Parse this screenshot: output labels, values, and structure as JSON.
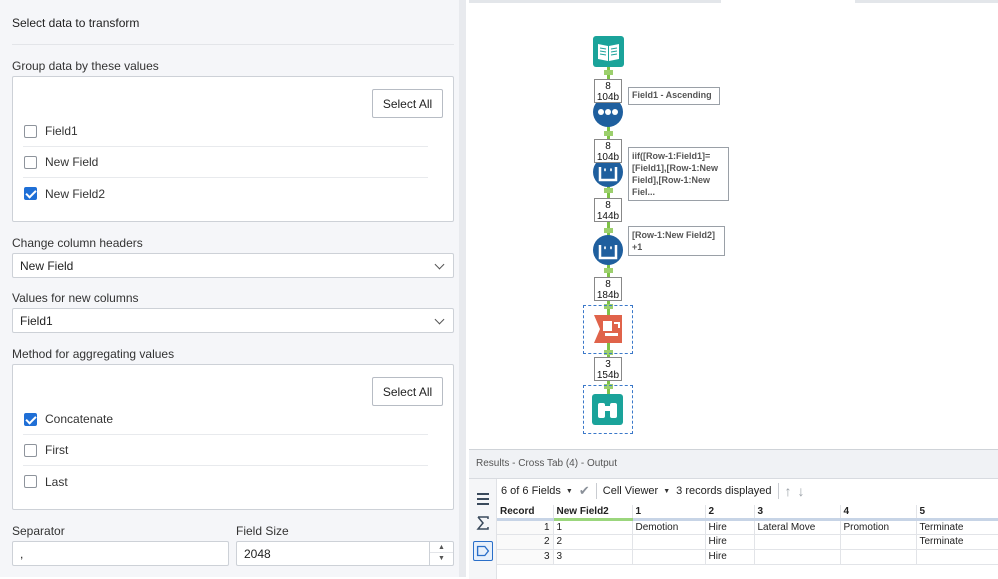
{
  "config": {
    "title": "Select data to transform",
    "group_section": {
      "label": "Group data by these values",
      "select_all": "Select All",
      "fields": [
        {
          "label": "Field1",
          "checked": false
        },
        {
          "label": "New Field",
          "checked": false
        },
        {
          "label": "New Field2",
          "checked": true
        }
      ]
    },
    "change_headers": {
      "label": "Change column headers",
      "value": "New Field"
    },
    "values_columns": {
      "label": "Values for new columns",
      "value": "Field1"
    },
    "aggregate_section": {
      "label": "Method for aggregating values",
      "select_all": "Select All",
      "methods": [
        {
          "label": "Concatenate",
          "checked": true
        },
        {
          "label": "First",
          "checked": false
        },
        {
          "label": "Last",
          "checked": false
        }
      ]
    },
    "separator": {
      "label": "Separator",
      "value": ","
    },
    "field_size": {
      "label": "Field Size",
      "value": "2048"
    }
  },
  "canvas": {
    "record_counts": [
      {
        "count": "8",
        "size": "104b"
      },
      {
        "count": "8",
        "size": "104b"
      },
      {
        "count": "8",
        "size": "144b"
      },
      {
        "count": "8",
        "size": "184b"
      },
      {
        "count": "3",
        "size": "154b"
      }
    ],
    "annotations": [
      "Field1 - Ascending",
      "iif([Row-1:Field1]=\n[Field1],[Row-1:New\nField],[Row-1:New\nFiel...",
      "[Row-1:New Field2]\n+1"
    ],
    "colors": {
      "input": "#1aa39a",
      "sort": "#1f5f9e",
      "formula": "#1f5f9e",
      "crosstab": "#e0634a",
      "browse": "#1aa39a",
      "connector": "#7ec247"
    }
  },
  "results": {
    "header": "Results - Cross Tab (4) - Output",
    "fields_selector": "6 of 6 Fields",
    "cell_viewer": "Cell Viewer",
    "records_displayed": "3 records displayed",
    "columns": [
      "Record",
      "New Field2",
      "1",
      "2",
      "3",
      "4",
      "5"
    ],
    "rows": [
      [
        "1",
        "1",
        "Demotion",
        "Hire",
        "Lateral Move",
        "Promotion",
        "Terminate"
      ],
      [
        "2",
        "2",
        "",
        "Hire",
        "",
        "",
        "Terminate"
      ],
      [
        "3",
        "3",
        "",
        "Hire",
        "",
        "",
        ""
      ]
    ]
  }
}
